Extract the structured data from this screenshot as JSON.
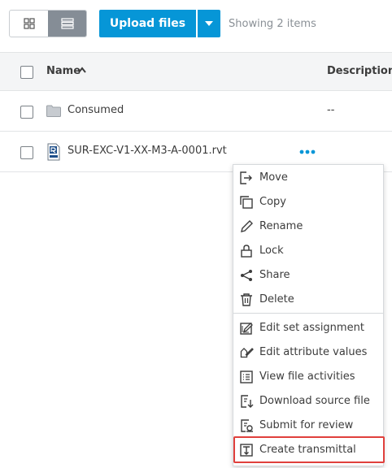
{
  "toolbar": {
    "view_grid_icon": "grid-icon",
    "view_list_icon": "list-icon",
    "upload_label": "Upload files",
    "count_text": "Showing 2 items"
  },
  "table": {
    "columns": {
      "name": "Name",
      "description": "Description"
    },
    "rows": [
      {
        "name": "Consumed",
        "description": "--",
        "icon": "folder-icon"
      },
      {
        "name": "SUR-EXC-V1-XX-M3-A-0001.rvt",
        "description": "",
        "icon": "revit-file-icon"
      }
    ]
  },
  "menu": {
    "items": [
      {
        "label": "Move",
        "icon": "move-icon"
      },
      {
        "label": "Copy",
        "icon": "copy-icon"
      },
      {
        "label": "Rename",
        "icon": "pencil-icon"
      },
      {
        "label": "Lock",
        "icon": "lock-icon"
      },
      {
        "label": "Share",
        "icon": "share-icon"
      },
      {
        "label": "Delete",
        "icon": "trash-icon"
      },
      {
        "label": "Edit set assignment",
        "icon": "edit-set-icon"
      },
      {
        "label": "Edit attribute values",
        "icon": "edit-attribute-icon"
      },
      {
        "label": "View file activities",
        "icon": "activities-icon"
      },
      {
        "label": "Download source file",
        "icon": "download-icon"
      },
      {
        "label": "Submit for review",
        "icon": "review-icon"
      },
      {
        "label": "Create transmittal",
        "icon": "transmittal-icon"
      }
    ]
  },
  "colors": {
    "primary": "#0696d7",
    "highlight": "#e0403c",
    "toggle_active": "#858d96"
  }
}
